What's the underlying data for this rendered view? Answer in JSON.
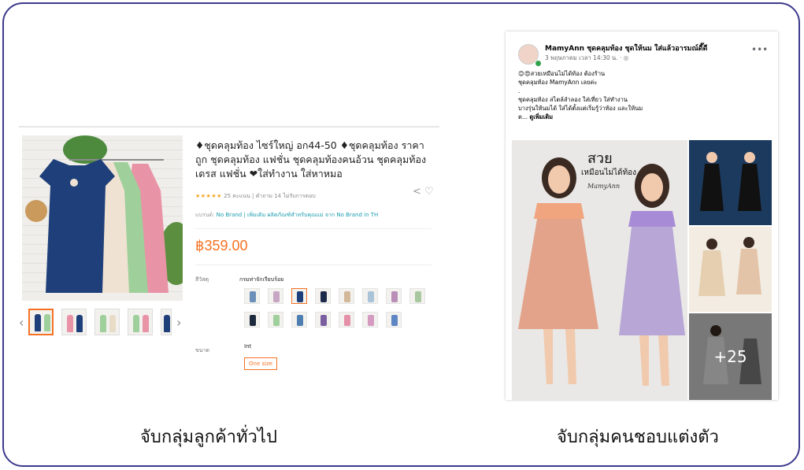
{
  "left_panel": {
    "product_title": "♦ชุดคลุมท้อง ไซร์ใหญ่ อก44-50 ♦ชุดคลุมท้อง ราคาถูก ชุดคลุมท้อง แฟชั่น ชุดคลุมท้องคนอ้วน ชุดคลุมท้อง เดรส แฟชั่น ❤ใส่ทำงาน ใส่หาหมอ",
    "stars": "★★★★★",
    "rating_text": "25 คะแนน | คำถาม 14 ไม่รับการตอบ",
    "brand_prefix": "แบรนด์:",
    "brand_link": "No Brand | เพิ่มเติม ผลิตภัณฑ์สำหรับคุณแม่ จาก No Brand in TH",
    "price": "฿359.00",
    "color_label": "สีวัสดุ",
    "color_name": "กรมท่าจักเรียบร้อย",
    "size_label": "ขนาด",
    "size_value": "Int",
    "size_option": "One size",
    "colors": {
      "accent": "#f57224",
      "link": "#1a9cb0"
    }
  },
  "right_panel": {
    "page_name": "MamyAnn ชุดคลุมท้อง ชุดให้นม ใส่แล้วอารมณ์ดี๊ดี",
    "post_time": "3 พฤษภาคม เวลา 14:30 น. · ◎",
    "text_line1": "😊😍สวยเหมือนไม่ได้ท้อง  ต้องร้าน",
    "text_line2": "ชุดคลุมท้อง MamyAnn เลยค่ะ",
    "text_line3": ".",
    "text_line4": "ชุดคลุมท้อง สไตล์ลำลอง ใส่เที่ยว ใส่ทำงาน",
    "text_line5": "บางรุ่นให้นมได้ ใส่ได้ตั้งแต่เริ่มรู้ว่าท้อง และให้นม",
    "text_line6_prefix": "ต...",
    "see_more": "ดูเพิ่มเติม",
    "photo_headline": "สวย",
    "photo_sub": "เหมือนไม่ได้ท้อง",
    "photo_brand": "MamyAnn",
    "more_count": "+25"
  },
  "captions": {
    "left": "จับกลุ่มลูกค้าทั่วไป",
    "right": "จับกลุ่มคนชอบแต่งตัว"
  }
}
